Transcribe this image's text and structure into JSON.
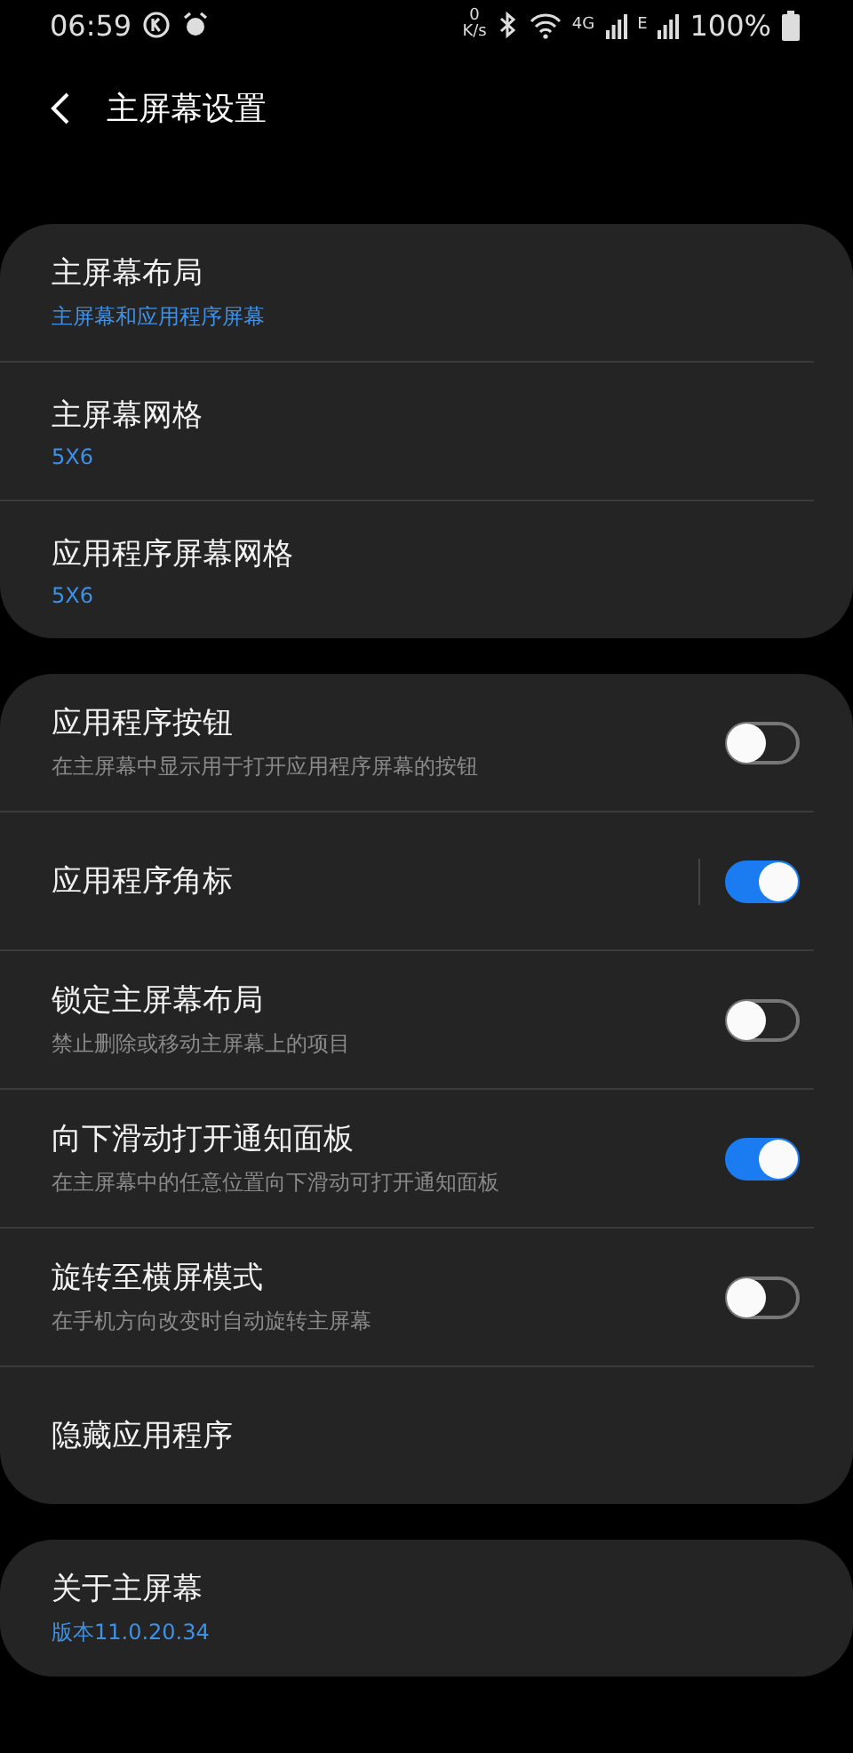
{
  "status_bar": {
    "time": "06:59",
    "net_speed_value": "0",
    "net_speed_unit": "K/s",
    "network_1": "4G",
    "network_2": "E",
    "battery": "100%"
  },
  "header": {
    "title": "主屏幕设置"
  },
  "groups": [
    {
      "items": [
        {
          "kind": "value",
          "title": "主屏幕布局",
          "value": "主屏幕和应用程序屏幕"
        },
        {
          "kind": "value",
          "title": "主屏幕网格",
          "value": "5X6"
        },
        {
          "kind": "value",
          "title": "应用程序屏幕网格",
          "value": "5X6"
        }
      ]
    },
    {
      "items": [
        {
          "kind": "toggle",
          "title": "应用程序按钮",
          "subtitle": "在主屏幕中显示用于打开应用程序屏幕的按钮",
          "on": false
        },
        {
          "kind": "split_toggle",
          "title": "应用程序角标",
          "on": true
        },
        {
          "kind": "toggle",
          "title": "锁定主屏幕布局",
          "subtitle": "禁止删除或移动主屏幕上的项目",
          "on": false
        },
        {
          "kind": "toggle",
          "title": "向下滑动打开通知面板",
          "subtitle": "在主屏幕中的任意位置向下滑动可打开通知面板",
          "on": true
        },
        {
          "kind": "toggle",
          "title": "旋转至横屏模式",
          "subtitle": "在手机方向改变时自动旋转主屏幕",
          "on": false
        },
        {
          "kind": "plain",
          "title": "隐藏应用程序"
        }
      ]
    },
    {
      "items": [
        {
          "kind": "value",
          "title": "关于主屏幕",
          "value": "版本11.0.20.34"
        }
      ]
    }
  ]
}
